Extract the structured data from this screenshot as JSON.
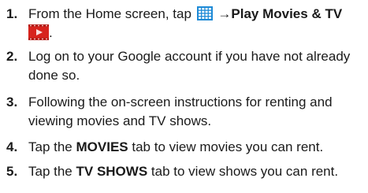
{
  "steps": [
    {
      "number": "1.",
      "text_before": "From the Home screen, tap",
      "arrow": "→",
      "bold_target": "Play Movies & TV",
      "trailing": ".",
      "icons": [
        "apps-grid-icon",
        "play-movies-icon"
      ]
    },
    {
      "number": "2.",
      "line1": "Log on to your Google account if you have not already",
      "line2": "done so."
    },
    {
      "number": "3.",
      "line1": "Following the on-screen instructions for renting and",
      "line2": "viewing movies and TV shows."
    },
    {
      "number": "4.",
      "text_before": "Tap the",
      "bold": "MOVIES",
      "text_after": "tab to view movies you can rent."
    },
    {
      "number": "5.",
      "text_before": "Tap the",
      "bold": "TV SHOWS",
      "text_after": "tab to view shows you can rent."
    }
  ],
  "colors": {
    "text": "#1a1a1a",
    "apps_icon_blue": "#1e8ad6",
    "movie_icon_red": "#d7231d"
  }
}
